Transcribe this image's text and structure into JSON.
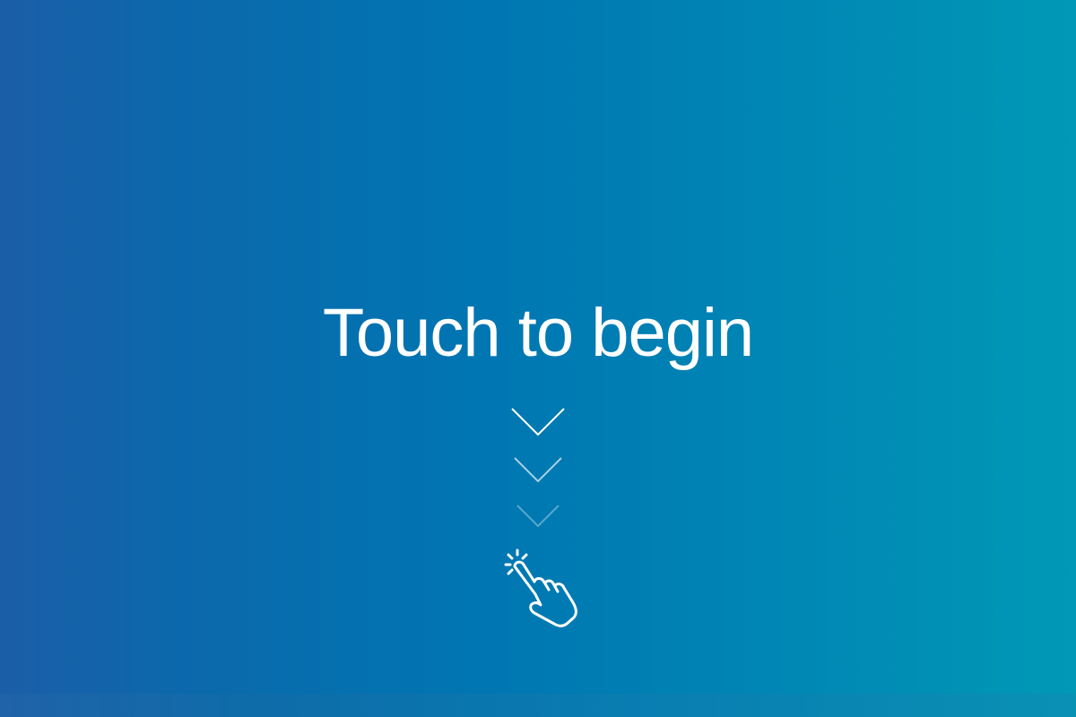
{
  "screen": {
    "title": "Touch to begin",
    "prompt_icon": "tap-hand-icon",
    "indicator_icons": [
      "chevron-down-icon",
      "chevron-down-icon",
      "chevron-down-icon"
    ]
  },
  "colors": {
    "gradient_start": "#1a5ea8",
    "gradient_end": "#0098b6",
    "text": "#ffffff"
  }
}
